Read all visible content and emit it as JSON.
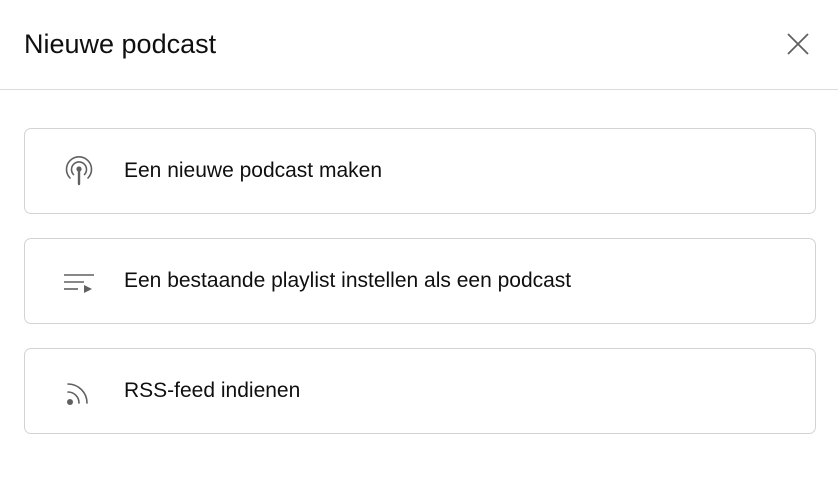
{
  "dialog": {
    "title": "Nieuwe podcast",
    "close_icon": "close-icon"
  },
  "options": [
    {
      "icon": "podcast-icon",
      "label": "Een nieuwe podcast maken"
    },
    {
      "icon": "playlist-play-icon",
      "label": "Een bestaande playlist instellen als een podcast"
    },
    {
      "icon": "rss-feed-icon",
      "label": "RSS-feed indienen"
    }
  ],
  "colors": {
    "text": "#0f0f0f",
    "icon": "#606060",
    "border": "#d3d3d3",
    "divider": "#dcdcdc"
  }
}
